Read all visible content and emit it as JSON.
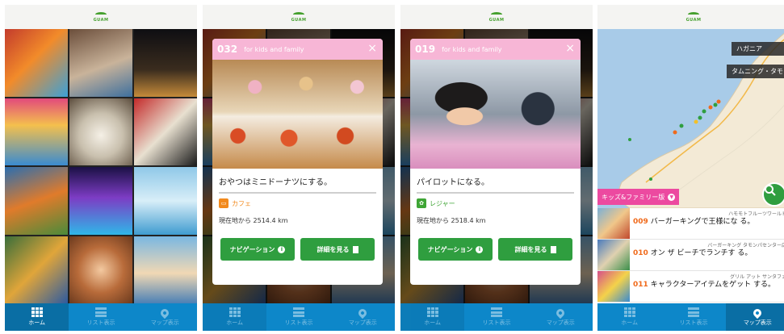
{
  "logo": {
    "text": "GUAM"
  },
  "tabs": {
    "home": "ホーム",
    "list": "リスト表示",
    "map": "マップ表示"
  },
  "screen2": {
    "number": "032",
    "tag": "for kids and family",
    "close": "×",
    "title": "おやつはミニドーナツにする。",
    "category": "カフェ",
    "distance": "現在地から 2514.4 km",
    "nav_label": "ナビゲーション",
    "detail_label": "詳細を見る",
    "category_color": "#f28a1e"
  },
  "screen3": {
    "number": "019",
    "tag": "for kids and family",
    "close": "×",
    "title": "パイロットになる。",
    "category": "レジャー",
    "distance": "現在地から 2518.4 km",
    "nav_label": "ナビゲーション",
    "detail_label": "詳細を見る",
    "category_color": "#3fa535"
  },
  "screen4": {
    "map_labels": [
      "ハガニア",
      "タムニング・タモ"
    ],
    "filter_label": "キッズ&ファミリー版",
    "list": [
      {
        "sub": "ハモモトフルーツワールド",
        "num": "009",
        "title": "バーガーキングで王様にな る。"
      },
      {
        "sub": "バーガーキング タモンパセンター店",
        "num": "010",
        "title": "オン ザ ビーチでランチす る。"
      },
      {
        "sub": "グリル アット サンタフェ",
        "num": "011",
        "title": "キャラクターアイテムをゲット する。"
      }
    ]
  },
  "colors": {
    "tabbar": "#0d87c9",
    "button_green": "#2f9e3f",
    "modal_header_pink": "#f7b6d6",
    "filter_pink": "#ec4aa0",
    "item_number_orange": "#f06a1b"
  }
}
